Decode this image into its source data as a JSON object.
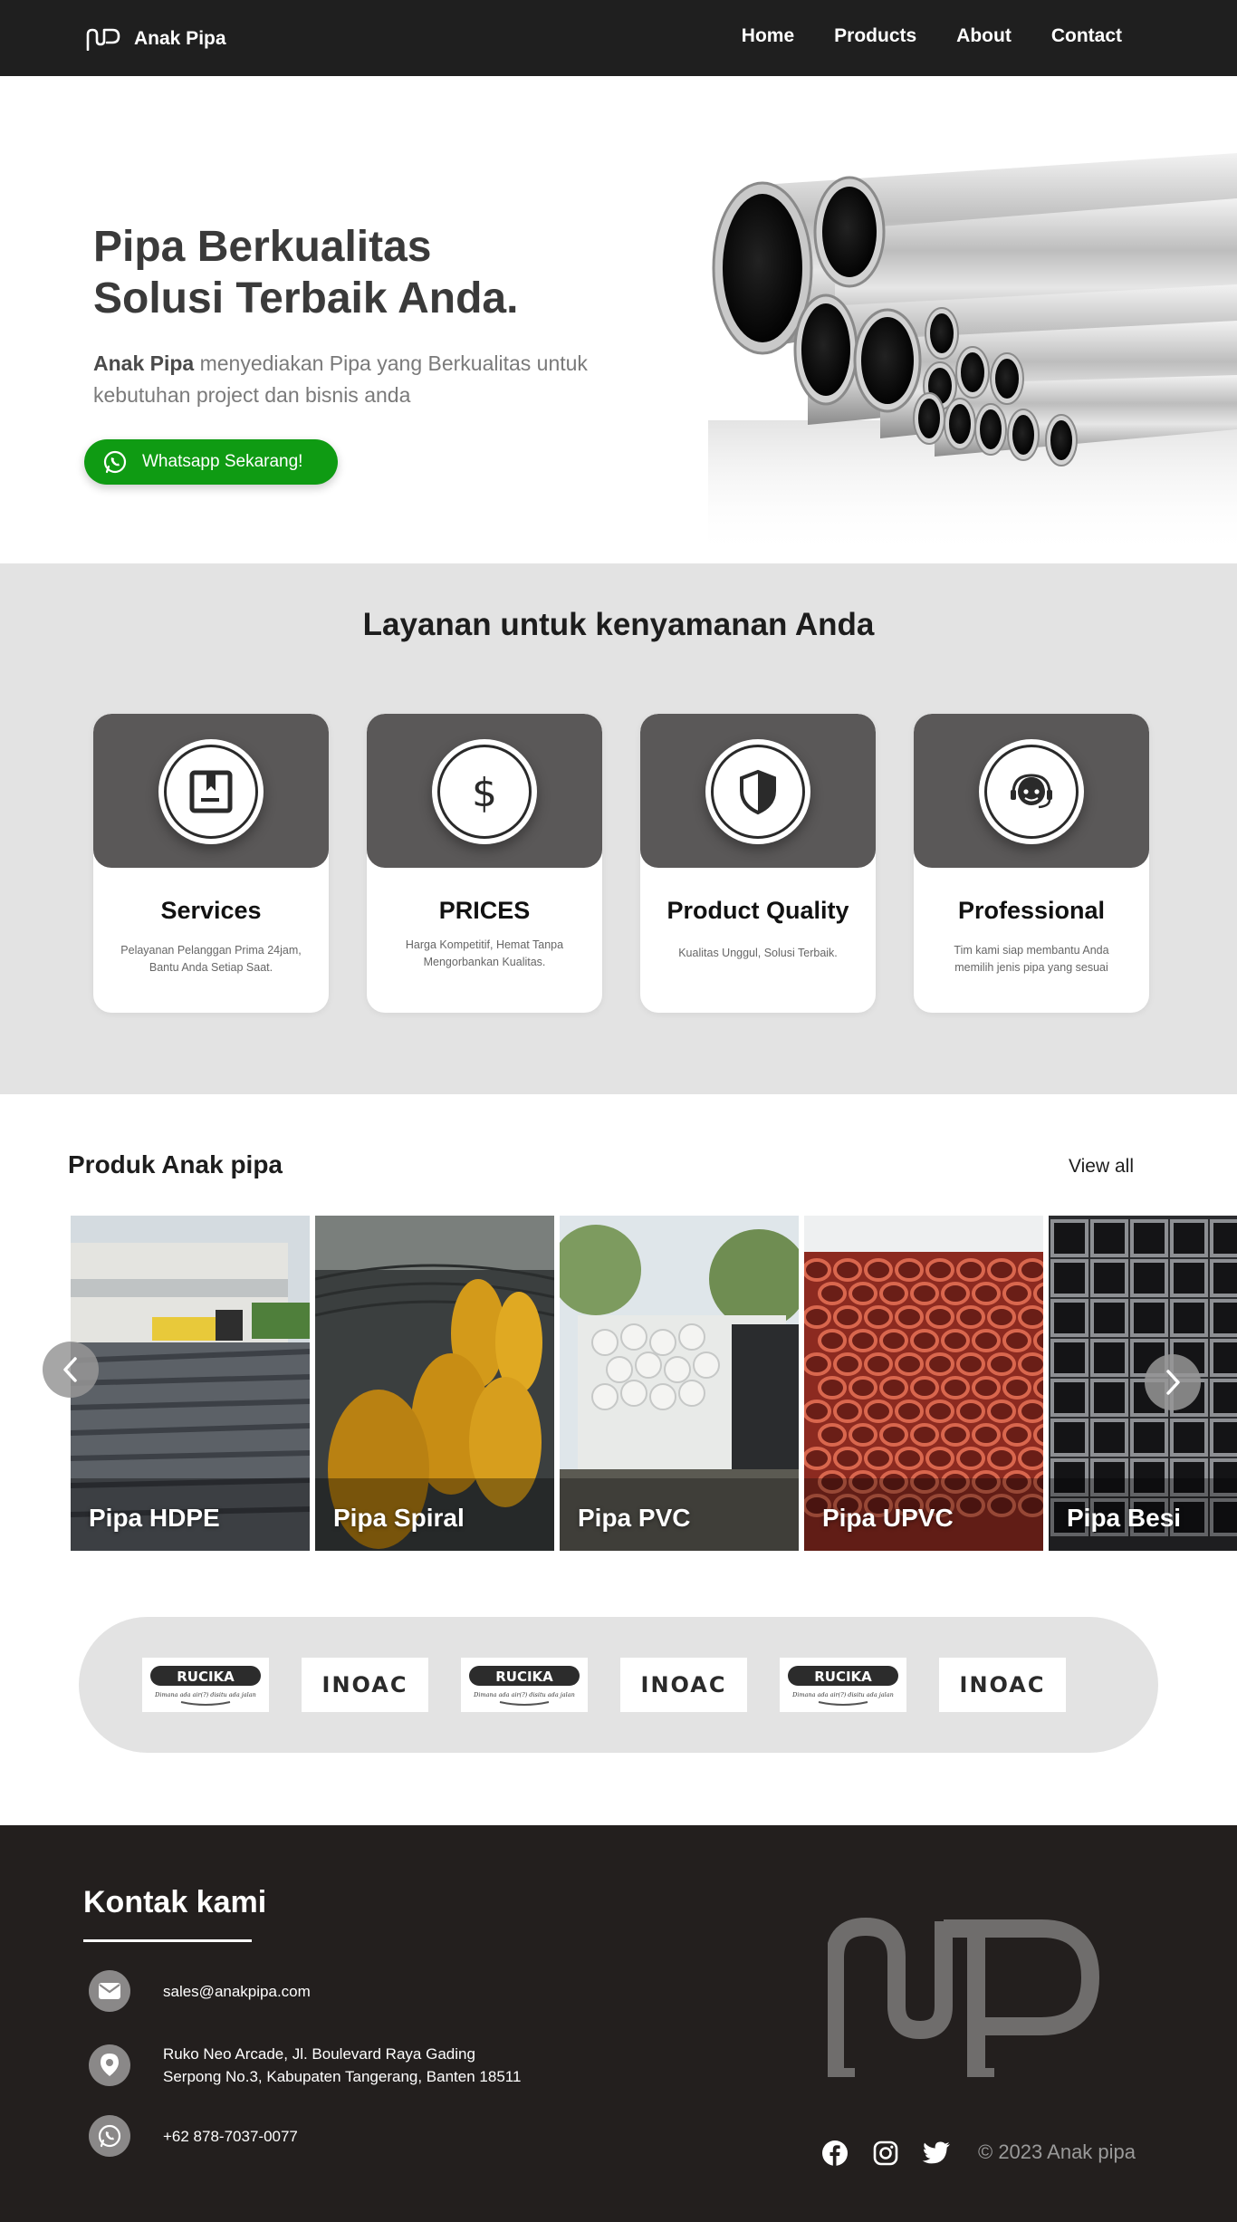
{
  "nav": {
    "brand": "Anak Pipa",
    "links": [
      "Home",
      "Products",
      "About",
      "Contact"
    ]
  },
  "hero": {
    "title_line1": "Pipa Berkualitas",
    "title_line2": "Solusi Terbaik Anda.",
    "subtitle_brand": "Anak Pipa",
    "subtitle_rest": " menyediakan Pipa yang Berkualitas untuk kebutuhan project dan bisnis anda",
    "cta": "Whatsapp Sekarang!",
    "cta_color": "#0f9b13"
  },
  "services": {
    "title": "Layanan untuk kenyamanan Anda",
    "cards": [
      {
        "title": "Services",
        "desc": "Pelayanan Pelanggan Prima 24jam, Bantu Anda Setiap Saat.",
        "icon": "bookmark-box-icon"
      },
      {
        "title": "PRICES",
        "desc": "Harga Kompetitif, Hemat Tanpa Mengorbankan Kualitas.",
        "icon": "dollar-icon"
      },
      {
        "title": "Product Quality",
        "desc": "Kualitas Unggul, Solusi Terbaik.",
        "icon": "shield-icon"
      },
      {
        "title": "Professional",
        "desc": "Tim kami siap membantu Anda memilih jenis pipa yang sesuai",
        "icon": "support-agent-icon"
      }
    ]
  },
  "products": {
    "title": "Produk Anak pipa",
    "view_all": "View all",
    "items": [
      "Pipa HDPE",
      "Pipa Spiral",
      "Pipa PVC",
      "Pipa UPVC",
      "Pipa Besi"
    ]
  },
  "brands": {
    "logos": [
      "RUCIKA",
      "INOAC",
      "RUCIKA",
      "INOAC",
      "RUCIKA",
      "INOAC"
    ],
    "rucika_tagline": "Dimana ada air(?) disitu ada jalan"
  },
  "footer": {
    "title": "Kontak kami",
    "email": "sales@anakpipa.com",
    "address_line1": "Ruko Neo Arcade, Jl. Boulevard Raya Gading",
    "address_line2": "Serpong No.3, Kabupaten Tangerang, Banten 18511",
    "phone": "+62 878-7037-0077",
    "copyright": "© 2023 Anak pipa"
  }
}
